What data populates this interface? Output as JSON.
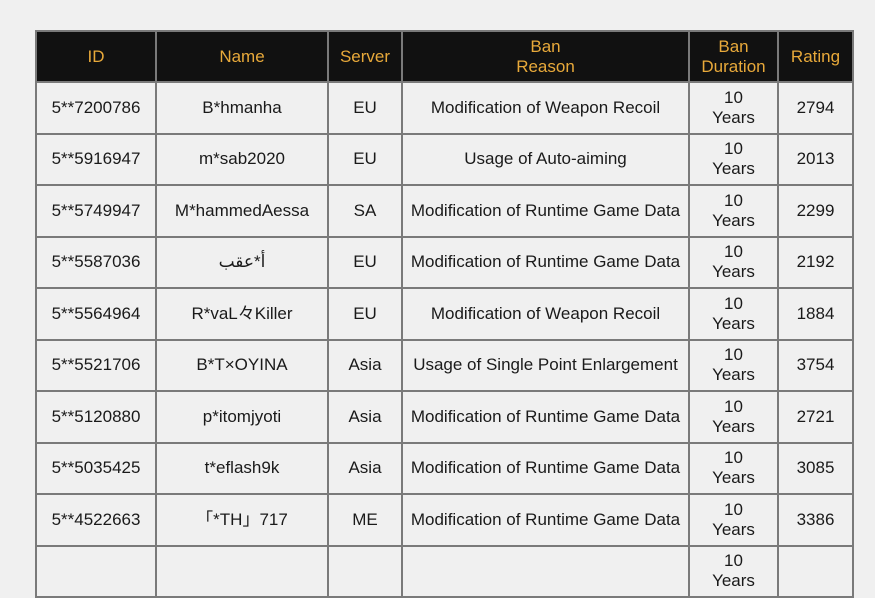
{
  "colors": {
    "header_bg": "#111111",
    "header_text": "#e8a93a",
    "cell_bg": "#f0f0f0",
    "border": "#7a7a7a"
  },
  "table": {
    "headers": {
      "id": "ID",
      "name": "Name",
      "server": "Server",
      "reason": "Ban\nReason",
      "duration": "Ban\nDuration",
      "rating": "Rating"
    },
    "rows": [
      {
        "id": "5**7200786",
        "name": "B*hmanha",
        "server": "EU",
        "reason": "Modification of Weapon Recoil",
        "duration": "10\nYears",
        "rating": "2794"
      },
      {
        "id": "5**5916947",
        "name": "m*sab2020",
        "server": "EU",
        "reason": "Usage of Auto-aiming",
        "duration": "10\nYears",
        "rating": "2013"
      },
      {
        "id": "5**5749947",
        "name": "M*hammedAessa",
        "server": "SA",
        "reason": "Modification of Runtime Game Data",
        "duration": "10\nYears",
        "rating": "2299"
      },
      {
        "id": "5**5587036",
        "name": "أ*عقب",
        "server": "EU",
        "reason": "Modification of Runtime Game Data",
        "duration": "10\nYears",
        "rating": "2192"
      },
      {
        "id": "5**5564964",
        "name": "R*vaL々Killer",
        "server": "EU",
        "reason": "Modification of Weapon Recoil",
        "duration": "10\nYears",
        "rating": "1884"
      },
      {
        "id": "5**5521706",
        "name": "B*T×OYINA",
        "server": "Asia",
        "reason": "Usage of Single Point Enlargement",
        "duration": "10\nYears",
        "rating": "3754"
      },
      {
        "id": "5**5120880",
        "name": "p*itomjyoti",
        "server": "Asia",
        "reason": "Modification of Runtime Game Data",
        "duration": "10\nYears",
        "rating": "2721"
      },
      {
        "id": "5**5035425",
        "name": "t*eflash9k",
        "server": "Asia",
        "reason": "Modification of Runtime Game Data",
        "duration": "10\nYears",
        "rating": "3085"
      },
      {
        "id": "5**4522663",
        "name": "「*TH」717",
        "server": "ME",
        "reason": "Modification of Runtime Game Data",
        "duration": "10\nYears",
        "rating": "3386"
      },
      {
        "id": "",
        "name": "",
        "server": "",
        "reason": "",
        "duration": "10\nYears",
        "rating": ""
      }
    ]
  }
}
